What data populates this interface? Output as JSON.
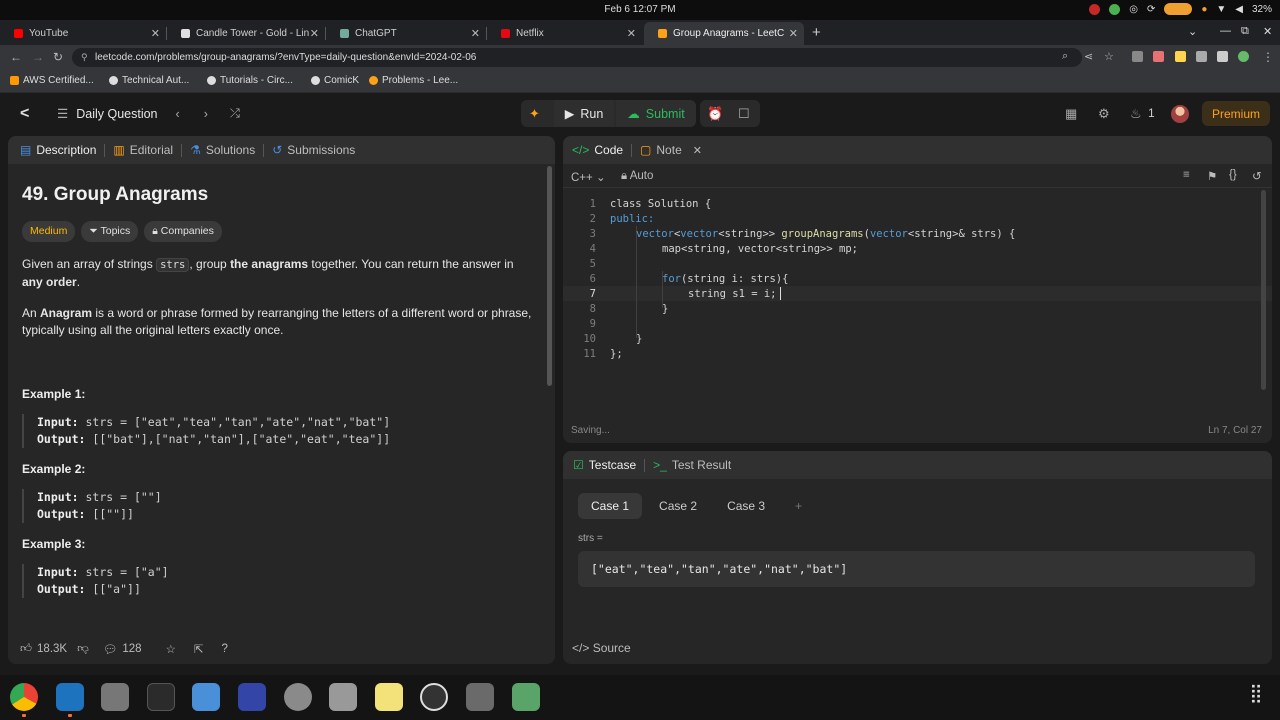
{
  "os": {
    "clock": "Feb 6  12:07 PM",
    "battery": "32%"
  },
  "browser": {
    "tabs": [
      {
        "label": "YouTube",
        "color": "#ff0000"
      },
      {
        "label": "Candle Tower - Gold - Lin",
        "color": "#e0e0e0"
      },
      {
        "label": "ChatGPT",
        "color": "#74aa9c"
      },
      {
        "label": "Netflix",
        "color": "#e50914"
      },
      {
        "label": "Group Anagrams - LeetC",
        "color": "#ffa116"
      }
    ],
    "url": "leetcode.com/problems/group-anagrams/?envType=daily-question&envId=2024-02-06",
    "bookmarks": [
      "AWS Certified...",
      "Technical Aut...",
      "Tutorials - Circ...",
      "ComicK",
      "Problems - Lee..."
    ]
  },
  "lc_header": {
    "daily_label": "Daily Question",
    "run_label": "Run",
    "submit_label": "Submit",
    "streak": "1",
    "premium_label": "Premium"
  },
  "desc": {
    "tabs": [
      "Description",
      "Editorial",
      "Solutions",
      "Submissions"
    ],
    "title": "49. Group Anagrams",
    "difficulty": "Medium",
    "topics_label": "Topics",
    "companies_label": "Companies",
    "p1_a": "Given an array of strings ",
    "p1_code": "strs",
    "p1_b": ", group ",
    "p1_bold1": "the anagrams",
    "p1_c": " together. You can return the answer in ",
    "p1_bold2": "any order",
    "p1_d": ".",
    "p2_a": "An ",
    "p2_bold": "Anagram",
    "p2_b": " is a word or phrase formed by rearranging the letters of a different word or phrase, typically using all the original letters exactly once.",
    "examples": [
      {
        "title": "Example 1:",
        "input": "strs = [\"eat\",\"tea\",\"tan\",\"ate\",\"nat\",\"bat\"]",
        "output": "[[\"bat\"],[\"nat\",\"tan\"],[\"ate\",\"eat\",\"tea\"]]"
      },
      {
        "title": "Example 2:",
        "input": "strs = [\"\"]",
        "output": "[[\"\"]]"
      },
      {
        "title": "Example 3:",
        "input": "strs = [\"a\"]",
        "output": "[[\"a\"]]"
      }
    ],
    "input_label": "Input:",
    "output_label": "Output:",
    "likes": "18.3K",
    "comments": "128"
  },
  "code": {
    "tab_code": "Code",
    "tab_note": "Note",
    "language": "C++",
    "auto_label": "Auto",
    "status_left": "Saving...",
    "status_right": "Ln 7, Col 27",
    "lines": [
      "1",
      "2",
      "3",
      "4",
      "5",
      "6",
      "7",
      "8",
      "9",
      "10",
      "11"
    ],
    "src": {
      "l1": "class Solution {",
      "l2": "public:",
      "l3_kw": "vector",
      "l3_a": "<",
      "l3_kw2": "vector",
      "l3_b": "<string>> ",
      "l3_fn": "groupAnagrams",
      "l3_c": "(",
      "l3_kw3": "vector",
      "l3_d": "<string>& strs) {",
      "l4": "map<string, vector<string>> mp;",
      "l6_kw": "for",
      "l6_a": "(string i: strs){",
      "l7": "string s1 = i;",
      "l8": "}",
      "l10": "}",
      "l11": "};"
    }
  },
  "test": {
    "tab_testcase": "Testcase",
    "tab_result": "Test Result",
    "cases": [
      "Case 1",
      "Case 2",
      "Case 3"
    ],
    "var_label": "strs =",
    "var_value": "[\"eat\",\"tea\",\"tan\",\"ate\",\"nat\",\"bat\"]",
    "source_label": "Source"
  }
}
